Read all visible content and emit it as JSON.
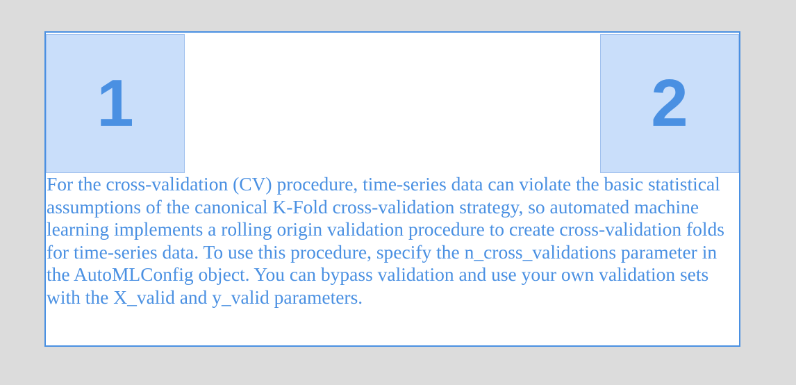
{
  "boxes": {
    "left_label": "1",
    "right_label": "2"
  },
  "paragraph": "For the cross-validation (CV) procedure, time-series data can violate the basic statistical assumptions of the canonical K-Fold cross-validation strategy, so automated machine learning implements a rolling origin validation procedure to create cross-validation folds for time-series data. To use this procedure, specify the n_cross_validations parameter in the AutoMLConfig object. You can bypass validation and use your own validation sets with the X_valid and y_valid parameters.",
  "colors": {
    "accent": "#4a90e2",
    "box_fill": "#c9defa",
    "background": "#dcdcdc"
  }
}
